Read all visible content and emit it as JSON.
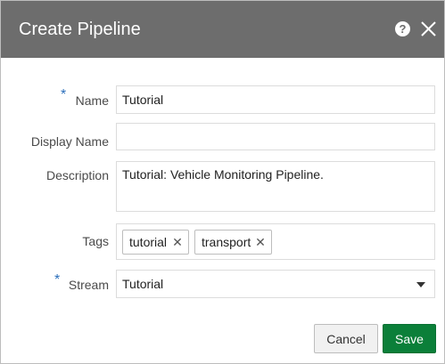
{
  "dialog": {
    "title": "Create Pipeline",
    "help_icon": "question-circle-icon",
    "help_glyph": "?",
    "close_icon": "close-icon"
  },
  "form": {
    "required_marker": "*",
    "name": {
      "label": "Name",
      "value": "Tutorial",
      "required": true
    },
    "display_name": {
      "label": "Display Name",
      "value": ""
    },
    "description": {
      "label": "Description",
      "value": "Tutorial: Vehicle Monitoring Pipeline."
    },
    "tags": {
      "label": "Tags",
      "remove_glyph": "✕",
      "items": [
        {
          "label": "tutorial"
        },
        {
          "label": "transport"
        }
      ]
    },
    "stream": {
      "label": "Stream",
      "value": "Tutorial",
      "required": true
    }
  },
  "buttons": {
    "cancel_label": "Cancel",
    "save_label": "Save"
  },
  "colors": {
    "titlebar": "#6d6d6d",
    "required_marker": "#2a6ebb",
    "save_button": "#0b7f39"
  }
}
